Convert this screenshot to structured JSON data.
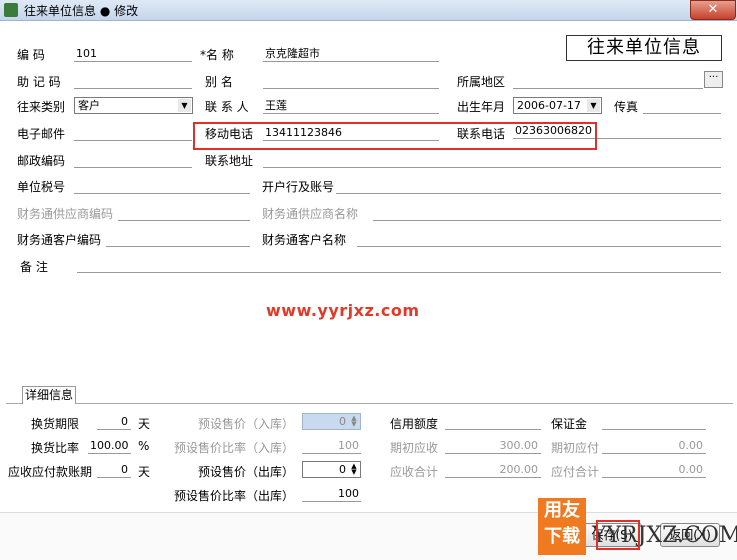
{
  "window": {
    "title": "往来单位信息 ● 修改",
    "close_label": "✕"
  },
  "header_title": "往来单位信息",
  "fields": {
    "code_label": "编 码",
    "code_value": "101",
    "name_label": "*名 称",
    "name_value": "京克隆超市",
    "mnemonic_label": "助 记 码",
    "mnemonic_value": "",
    "alias_label": "别 名",
    "alias_value": "",
    "region_label": "所属地区",
    "region_value": "",
    "type_label": "往来类别",
    "type_value": "客户",
    "contact_label": "联 系 人",
    "contact_value": "王莲",
    "birth_label": "出生年月",
    "birth_value": "2006-07-17",
    "fax_label": "传真",
    "fax_value": "",
    "email_label": "电子邮件",
    "email_value": "",
    "mobile_label": "移动电话",
    "mobile_value": "13411123846",
    "phone_label": "联系电话",
    "phone_value": "02363006820",
    "zip_label": "邮政编码",
    "zip_value": "",
    "address_label": "联系地址",
    "address_value": "",
    "tax_label": "单位税号",
    "tax_value": "",
    "bank_label": "开户行及账号",
    "bank_value": "",
    "cwt_supplier_code_label": "财务通供应商编码",
    "cwt_supplier_name_label": "财务通供应商名称",
    "cwt_customer_code_label": "财务通客户编码",
    "cwt_customer_name_label": "财务通客户名称",
    "remark_label": "备 注",
    "remark_value": ""
  },
  "watermark": "www.yyrjxz.com",
  "detail": {
    "tab_label": "详细信息",
    "exchange_period_label": "换货期限",
    "exchange_period_value": "0",
    "exchange_period_unit": "天",
    "exchange_ratio_label": "换货比率",
    "exchange_ratio_value": "100.00",
    "exchange_ratio_unit": "%",
    "payment_period_label": "应收应付款账期",
    "payment_period_value": "0",
    "payment_period_unit": "天",
    "preset_price_in_label": "预设售价（入库）",
    "preset_price_in_value": "0",
    "preset_ratio_in_label": "预设售价比率（入库）",
    "preset_ratio_in_value": "100",
    "preset_price_out_label": "预设售价（出库）",
    "preset_price_out_value": "0",
    "preset_ratio_out_label": "预设售价比率（出库）",
    "preset_ratio_out_value": "100",
    "credit_label": "信用额度",
    "credit_value": "",
    "deposit_label": "保证金",
    "deposit_value": "",
    "init_receivable_label": "期初应收",
    "init_receivable_value": "300.00",
    "init_payable_label": "期初应付",
    "init_payable_value": "0.00",
    "receivable_total_label": "应收合计",
    "receivable_total_value": "200.00",
    "payable_total_label": "应付合计",
    "payable_total_value": "0.00"
  },
  "buttons": {
    "save_label": "保存(S)",
    "back_label": "返回(X)"
  },
  "logo": {
    "line1": "用友",
    "line2": "下载",
    "text": "YYRJXZ.COM"
  }
}
